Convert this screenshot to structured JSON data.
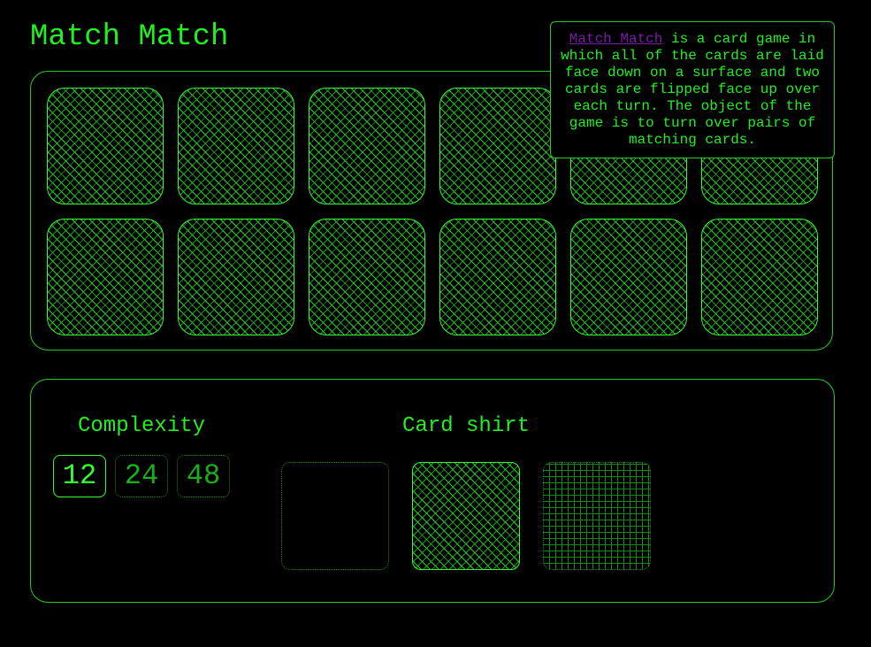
{
  "app": {
    "title": "Match Match"
  },
  "info": {
    "link_text": "Match Match",
    "description": " is a card game in which all of the cards are laid face down on a surface and two cards are flipped face up over each turn. The object of the game is to turn over pairs of matching cards."
  },
  "board": {
    "cards": [
      {
        "state": "face-down"
      },
      {
        "state": "face-down"
      },
      {
        "state": "face-down"
      },
      {
        "state": "face-down"
      },
      {
        "state": "face-down"
      },
      {
        "state": "face-down"
      },
      {
        "state": "face-down"
      },
      {
        "state": "face-down"
      },
      {
        "state": "face-down"
      },
      {
        "state": "face-down"
      },
      {
        "state": "face-down"
      },
      {
        "state": "face-down"
      }
    ]
  },
  "settings": {
    "complexity_label": "Complexity",
    "complexity_options": [
      "12",
      "24",
      "48"
    ],
    "complexity_selected": "12",
    "card_shirt_label": "Card shirt",
    "card_shirt_options": [
      "blank",
      "diagonal-lattice",
      "grid"
    ],
    "card_shirt_selected": "diagonal-lattice"
  },
  "colors": {
    "background": "#000000",
    "accent": "#22ee22",
    "link": "#7a1aa8"
  }
}
